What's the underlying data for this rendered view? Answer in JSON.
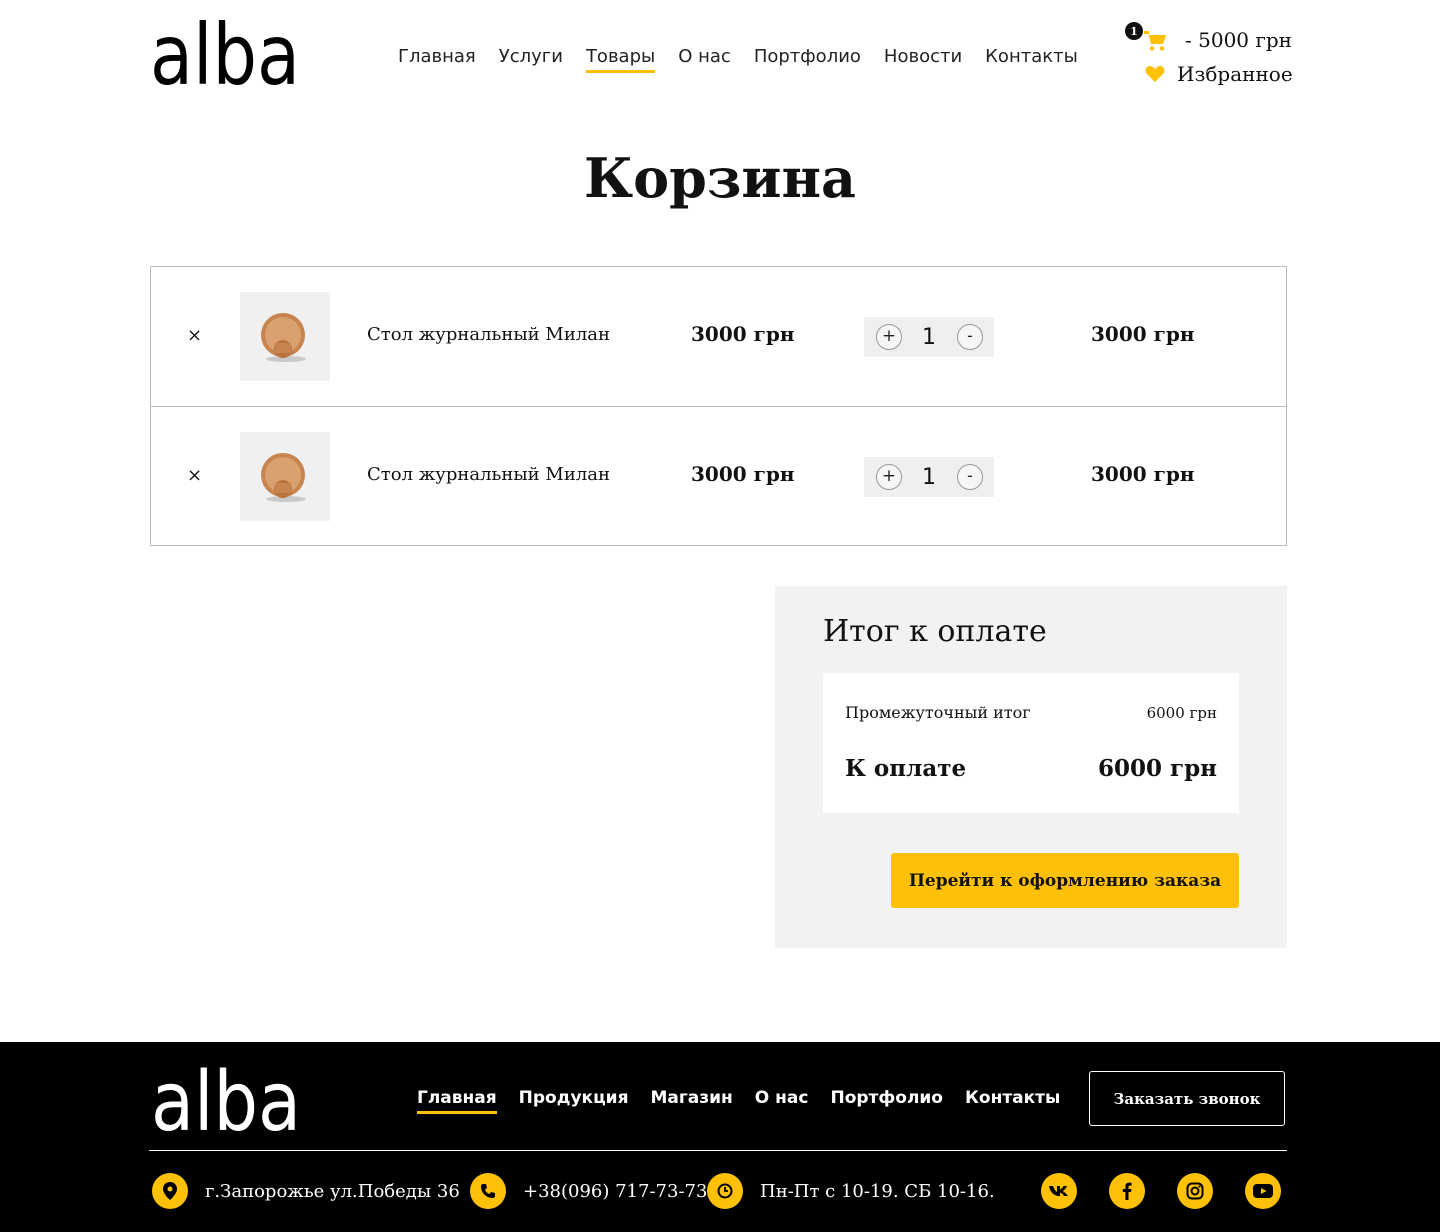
{
  "brand": {
    "logo_text": "alba",
    "accent": "#FFC107"
  },
  "header": {
    "nav": [
      "Главная",
      "Услуги",
      "Товары",
      "О нас",
      "Портфолио",
      "Новости",
      "Контакты"
    ],
    "active_nav": "Товары",
    "cart": {
      "count": "1",
      "total": "- 5000 грн",
      "icon": "cart-icon"
    },
    "favorites": {
      "label": "Избранное",
      "icon": "heart-icon"
    }
  },
  "page_title": "Корзина",
  "cart_items": [
    {
      "remove": "×",
      "name": "Стол журнальный Милан",
      "price": "3000 грн",
      "plus": "+",
      "qty": "1",
      "minus": "-",
      "total": "3000 грн"
    },
    {
      "remove": "×",
      "name": "Стол журнальный Милан",
      "price": "3000 грн",
      "plus": "+",
      "qty": "1",
      "minus": "-",
      "total": "3000 грн"
    }
  ],
  "summary": {
    "title": "Итог к оплате",
    "subtotal_label": "Промежуточный итог",
    "subtotal_value": "6000 грн",
    "pay_label": "К оплате",
    "pay_value": "6000 грн",
    "checkout_label": "Перейти к оформлению заказа"
  },
  "footer": {
    "nav": [
      "Главная",
      "Продукция",
      "Магазин",
      "О нас",
      "Портфолио",
      "Контакты"
    ],
    "active_nav": "Главная",
    "call_label": "Заказать звонок",
    "address": "г.Запорожье ул.Победы 36",
    "phone": "+38(096) 717-73-73",
    "hours": "Пн-Пт с 10-19. СБ 10-16.",
    "social": [
      "vk-icon",
      "facebook-icon",
      "instagram-icon",
      "youtube-icon"
    ]
  }
}
